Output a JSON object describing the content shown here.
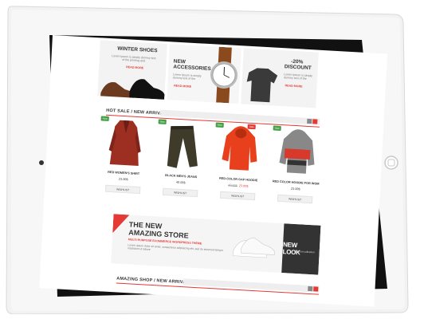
{
  "banners": [
    {
      "title": "WINTER SHOES",
      "desc": "Lorem Ipsum is simply dummy text of the printing and",
      "link": "READ MORE"
    },
    {
      "title_line1": "NEW",
      "title_line2": "ACCESSORIES",
      "desc": "Lorem Ipsum is simply dummy text of the",
      "link": "READ MORE"
    },
    {
      "title_line1": "-20%",
      "title_line2": "DISCOUNT",
      "desc": "Lorem Ipsum is simply dummy text of the",
      "link": "READ MORE"
    }
  ],
  "hot_sale": {
    "title": "HOT SALE / NEW ARRIVALS"
  },
  "products": [
    {
      "tag": "New",
      "name": "RED WOMEN'S SHIRT",
      "price": "23.00$",
      "old_price": "",
      "button": "WISHLIST",
      "tag_color": "#43a047"
    },
    {
      "tag": "New",
      "name": "BLACK MEN'S JEANS",
      "price": "40.00$",
      "old_price": "",
      "button": "WISHLIST",
      "tag_color": "#43a047"
    },
    {
      "tag": "Sale",
      "name": "RED-COLOR GAP HOODIE",
      "price": "23.00$",
      "old_price": "40.00$",
      "button": "WISHLIST",
      "tag_color": "#e53935"
    },
    {
      "tag": "New",
      "name": "RED COLOR HOODIE FOR WOM",
      "price": "23.00$",
      "old_price": "",
      "button": "WISHLIST",
      "tag_color": "#43a047"
    }
  ],
  "promo": {
    "title_line1": "THE NEW",
    "title_line2": "AMAZING STORE",
    "subtitle": "MULTI-PURPOSE ECOMMERCE WORDPRESS THEME",
    "desc": "Lorem ipsum dolor sit amet, consectetur adipisicing elit, sed do eiusmod tempor incididunt ut labore",
    "side_title": "NEW LOOK",
    "side_sub": "fashion collection"
  },
  "amazing_shop": {
    "title": "AMAZING SHOP / NEW ARRIVALS"
  },
  "colors": {
    "accent": "#e53935",
    "new_tag": "#43a047"
  }
}
